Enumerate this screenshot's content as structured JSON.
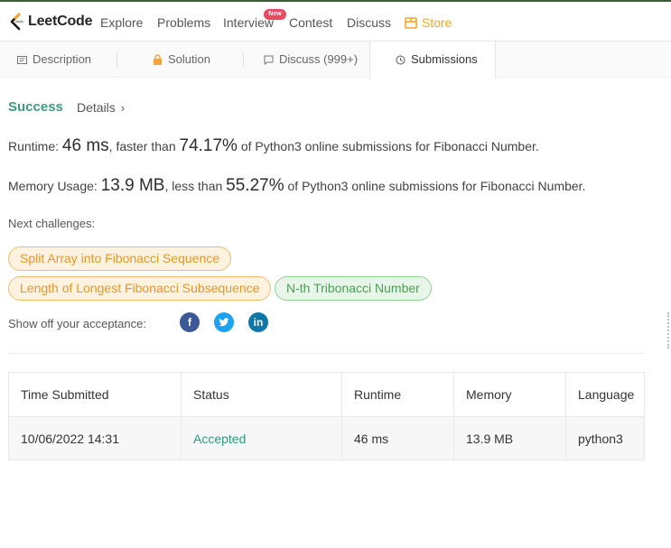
{
  "brand": {
    "name": "LeetCode"
  },
  "nav": {
    "items": [
      "Explore",
      "Problems",
      "Interview",
      "Contest",
      "Discuss"
    ],
    "badge": "New",
    "store": "Store"
  },
  "tabs": [
    "Description",
    "Solution",
    "Discuss (999+)",
    "Submissions"
  ],
  "result": {
    "status": "Success",
    "details": "Details",
    "runtime_label": "Runtime: ",
    "runtime_value": "46 ms",
    "runtime_mid": ", faster than ",
    "runtime_pct": "74.17%",
    "runtime_tail": " of Python3 online submissions for Fibonacci Number.",
    "memory_label": "Memory Usage: ",
    "memory_value": "13.9 MB",
    "memory_mid": ", less than ",
    "memory_pct": "55.27%",
    "memory_tail": " of Python3 online submissions for Fibonacci Number."
  },
  "challenges": {
    "label": "Next challenges:",
    "items": [
      "Split Array into Fibonacci Sequence",
      "Length of Longest Fibonacci Subsequence",
      "N-th Tribonacci Number"
    ]
  },
  "share": {
    "label": "Show off your acceptance:",
    "icons": [
      "facebook-icon",
      "twitter-icon",
      "linkedin-icon"
    ]
  },
  "table": {
    "headers": [
      "Time Submitted",
      "Status",
      "Runtime",
      "Memory",
      "Language"
    ],
    "rows": [
      [
        "10/06/2022 14:31",
        "Accepted",
        "46 ms",
        "13.9 MB",
        "python3"
      ]
    ]
  },
  "colors": {
    "accent_green": "#3e9a80",
    "store_orange": "#f5a623",
    "badge_red": "#e84a5f"
  }
}
